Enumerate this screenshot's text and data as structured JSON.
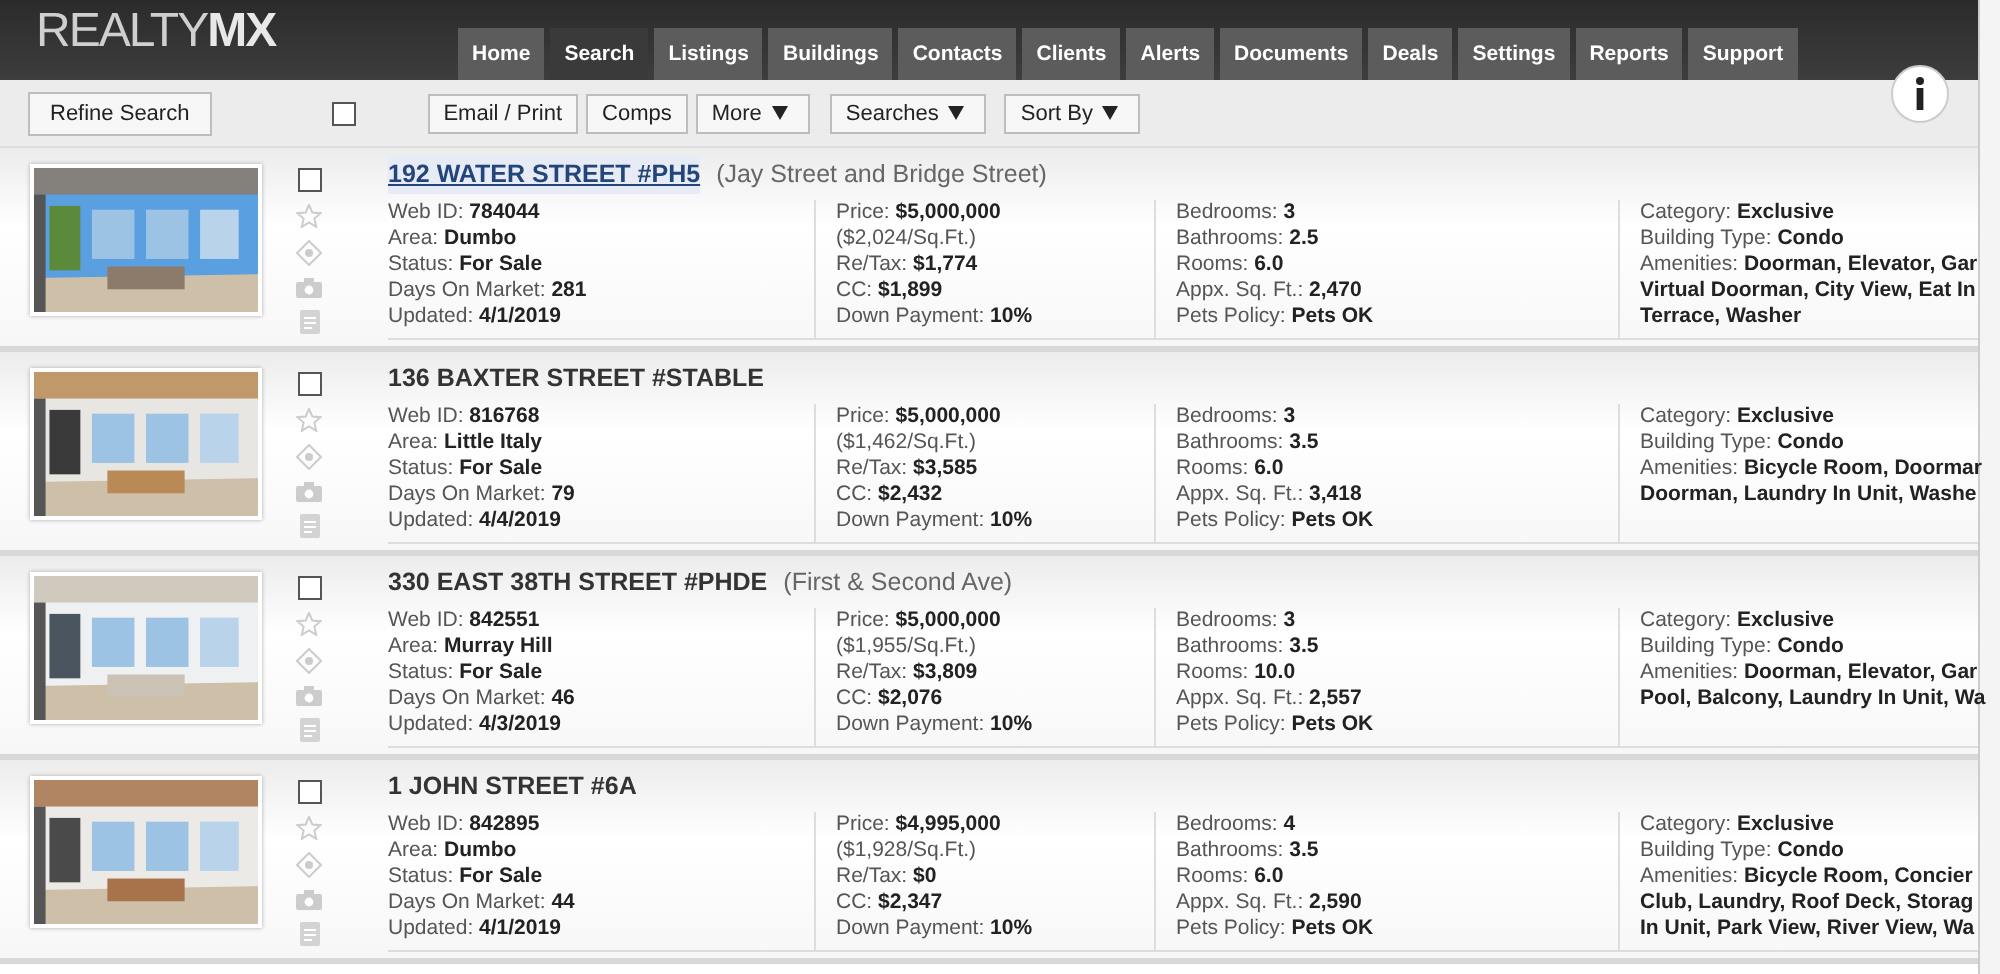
{
  "logo": {
    "light": "REALTY",
    "bold": "MX"
  },
  "nav_tabs": [
    {
      "label": "Home",
      "selected": false
    },
    {
      "label": "Search",
      "selected": true
    },
    {
      "label": "Listings",
      "selected": false
    },
    {
      "label": "Buildings",
      "selected": false
    },
    {
      "label": "Contacts",
      "selected": false
    },
    {
      "label": "Clients",
      "selected": false
    },
    {
      "label": "Alerts",
      "selected": false
    },
    {
      "label": "Documents",
      "selected": false
    },
    {
      "label": "Deals",
      "selected": false
    },
    {
      "label": "Settings",
      "selected": false
    },
    {
      "label": "Reports",
      "selected": false
    },
    {
      "label": "Support",
      "selected": false
    }
  ],
  "toolbar": {
    "refine_button": "Refine Search",
    "select_all": {
      "checked": false
    },
    "buttons": [
      {
        "label": "Email / Print",
        "dropdown": false
      },
      {
        "label": "Comps",
        "dropdown": false
      },
      {
        "label": "More",
        "dropdown": true
      },
      {
        "label": "Searches",
        "dropdown": true
      },
      {
        "label": "Sort By",
        "dropdown": true
      }
    ]
  },
  "listings": [
    {
      "title": "192 WATER STREET #PH5",
      "hovered": true,
      "cross_streets": "(Jay Street and Bridge Street)",
      "checked": false,
      "columns": [
        [
          {
            "label": "Web ID:",
            "value": "784044"
          },
          {
            "label": "Area:",
            "value": "Dumbo"
          },
          {
            "label": "Status:",
            "value": "For Sale"
          },
          {
            "label": "Days On Market:",
            "value": "281"
          },
          {
            "label": "Updated:",
            "value": "4/1/2019"
          }
        ],
        [
          {
            "label": "Price:",
            "value": "$5,000,000"
          },
          {
            "value": "($2,024/Sq.Ft.)"
          },
          {
            "label": "Re/Tax:",
            "value": "$1,774"
          },
          {
            "label": "CC:",
            "value": "$1,899"
          },
          {
            "label": "Down Payment:",
            "value": "10%"
          }
        ],
        [
          {
            "label": "Bedrooms:",
            "value": "3"
          },
          {
            "label": "Bathrooms:",
            "value": "2.5"
          },
          {
            "label": "Rooms:",
            "value": "6.0"
          },
          {
            "label": "Appx. Sq. Ft.:",
            "value": "2,470"
          },
          {
            "label": "Pets Policy:",
            "value": "Pets OK"
          }
        ],
        [
          {
            "label": "Category:",
            "value": "Exclusive"
          },
          {
            "label": "Building Type:",
            "value": "Condo"
          },
          {
            "label": "Amenities:",
            "value": "Doorman, Elevator, Gar",
            "more": [
              "Virtual Doorman, City View, Eat In",
              "Terrace, Washer"
            ]
          }
        ]
      ]
    },
    {
      "title": "136 BAXTER STREET #STABLE",
      "hovered": false,
      "checked": false,
      "columns": [
        [
          {
            "label": "Web ID:",
            "value": "816768"
          },
          {
            "label": "Area:",
            "value": "Little Italy"
          },
          {
            "label": "Status:",
            "value": "For Sale"
          },
          {
            "label": "Days On Market:",
            "value": "79"
          },
          {
            "label": "Updated:",
            "value": "4/4/2019"
          }
        ],
        [
          {
            "label": "Price:",
            "value": "$5,000,000"
          },
          {
            "value": "($1,462/Sq.Ft.)"
          },
          {
            "label": "Re/Tax:",
            "value": "$3,585"
          },
          {
            "label": "CC:",
            "value": "$2,432"
          },
          {
            "label": "Down Payment:",
            "value": "10%"
          }
        ],
        [
          {
            "label": "Bedrooms:",
            "value": "3"
          },
          {
            "label": "Bathrooms:",
            "value": "3.5"
          },
          {
            "label": "Rooms:",
            "value": "6.0"
          },
          {
            "label": "Appx. Sq. Ft.:",
            "value": "3,418"
          },
          {
            "label": "Pets Policy:",
            "value": "Pets OK"
          }
        ],
        [
          {
            "label": "Category:",
            "value": "Exclusive"
          },
          {
            "label": "Building Type:",
            "value": "Condo"
          },
          {
            "label": "Amenities:",
            "value": "Bicycle Room, Doormar",
            "more": [
              "Doorman, Laundry In Unit, Washe"
            ]
          }
        ]
      ]
    },
    {
      "title": "330 EAST 38TH STREET #PHDE",
      "hovered": false,
      "cross_streets": "(First & Second Ave)",
      "checked": false,
      "columns": [
        [
          {
            "label": "Web ID:",
            "value": "842551"
          },
          {
            "label": "Area:",
            "value": "Murray Hill"
          },
          {
            "label": "Status:",
            "value": "For Sale"
          },
          {
            "label": "Days On Market:",
            "value": "46"
          },
          {
            "label": "Updated:",
            "value": "4/3/2019"
          }
        ],
        [
          {
            "label": "Price:",
            "value": "$5,000,000"
          },
          {
            "value": "($1,955/Sq.Ft.)"
          },
          {
            "label": "Re/Tax:",
            "value": "$3,809"
          },
          {
            "label": "CC:",
            "value": "$2,076"
          },
          {
            "label": "Down Payment:",
            "value": "10%"
          }
        ],
        [
          {
            "label": "Bedrooms:",
            "value": "3"
          },
          {
            "label": "Bathrooms:",
            "value": "3.5"
          },
          {
            "label": "Rooms:",
            "value": "10.0"
          },
          {
            "label": "Appx. Sq. Ft.:",
            "value": "2,557"
          },
          {
            "label": "Pets Policy:",
            "value": "Pets OK"
          }
        ],
        [
          {
            "label": "Category:",
            "value": "Exclusive"
          },
          {
            "label": "Building Type:",
            "value": "Condo"
          },
          {
            "label": "Amenities:",
            "value": "Doorman, Elevator, Gar",
            "more": [
              "Pool, Balcony, Laundry In Unit, Wa"
            ]
          }
        ]
      ]
    },
    {
      "title": "1 JOHN STREET #6A",
      "hovered": false,
      "checked": false,
      "columns": [
        [
          {
            "label": "Web ID:",
            "value": "842895"
          },
          {
            "label": "Area:",
            "value": "Dumbo"
          },
          {
            "label": "Status:",
            "value": "For Sale"
          },
          {
            "label": "Days On Market:",
            "value": "44"
          },
          {
            "label": "Updated:",
            "value": "4/1/2019"
          }
        ],
        [
          {
            "label": "Price:",
            "value": "$4,995,000"
          },
          {
            "value": "($1,928/Sq.Ft.)"
          },
          {
            "label": "Re/Tax:",
            "value": "$0"
          },
          {
            "label": "CC:",
            "value": "$2,347"
          },
          {
            "label": "Down Payment:",
            "value": "10%"
          }
        ],
        [
          {
            "label": "Bedrooms:",
            "value": "4"
          },
          {
            "label": "Bathrooms:",
            "value": "3.5"
          },
          {
            "label": "Rooms:",
            "value": "6.0"
          },
          {
            "label": "Appx. Sq. Ft.:",
            "value": "2,590"
          },
          {
            "label": "Pets Policy:",
            "value": "Pets OK"
          }
        ],
        [
          {
            "label": "Category:",
            "value": "Exclusive"
          },
          {
            "label": "Building Type:",
            "value": "Condo"
          },
          {
            "label": "Amenities:",
            "value": "Bicycle Room, Concier",
            "more": [
              "Club, Laundry, Roof Deck, Storag",
              "In Unit, Park View, River View, Wa"
            ]
          }
        ]
      ]
    }
  ]
}
